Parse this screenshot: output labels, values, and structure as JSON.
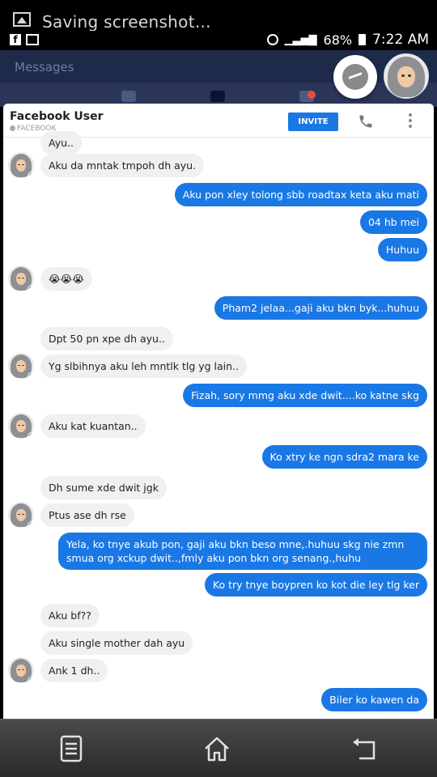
{
  "notification": {
    "text": "Saving screenshot..."
  },
  "status_bar": {
    "battery": "68%",
    "time": "7:22 AM"
  },
  "app_header": {
    "title": "Messages"
  },
  "conversation": {
    "name": "Facebook User",
    "source": "FACEBOOK",
    "invite_label": "INVITE"
  },
  "messages": [
    {
      "dir": "in",
      "text": "Ayu..",
      "avatar": false
    },
    {
      "dir": "in",
      "text": "Aku da mntak tmpoh dh ayu.",
      "avatar": true
    },
    {
      "dir": "out",
      "text": "Aku pon xley tolong sbb roadtax keta aku mati"
    },
    {
      "dir": "out",
      "text": "04 hb mei"
    },
    {
      "dir": "out",
      "text": "Huhuu"
    },
    {
      "dir": "in",
      "text": "😭😭😭",
      "avatar": true
    },
    {
      "dir": "out",
      "text": "Pham2 jelaa...gaji aku bkn byk...huhuu"
    },
    {
      "dir": "in",
      "text": "Dpt 50 pn xpe dh ayu..",
      "avatar": false
    },
    {
      "dir": "in",
      "text": "Yg slbihnya aku leh mntlk tlg yg lain..",
      "avatar": true
    },
    {
      "dir": "out",
      "text": "Fizah, sory mmg aku xde dwit....ko katne skg"
    },
    {
      "dir": "in",
      "text": "Aku kat kuantan..",
      "avatar": true
    },
    {
      "dir": "out",
      "text": "Ko xtry ke ngn sdra2 mara ke"
    },
    {
      "dir": "in",
      "text": "Dh sume xde dwit jgk",
      "avatar": false
    },
    {
      "dir": "in",
      "text": "Ptus ase dh rse",
      "avatar": true
    },
    {
      "dir": "out",
      "text": "Yela, ko tnye akub pon, gaji aku bkn beso mne,.huhuu skg nie zmn smua org xckup dwit..,fmly aku pon bkn org senang.,huhu"
    },
    {
      "dir": "out",
      "text": "Ko try tnye boypren ko kot die ley tlg ker"
    },
    {
      "dir": "in",
      "text": "Aku bf??",
      "avatar": false
    },
    {
      "dir": "in",
      "text": "Aku single mother dah ayu",
      "avatar": false
    },
    {
      "dir": "in",
      "text": "Ank 1 dh..",
      "avatar": true
    },
    {
      "dir": "out",
      "text": "Biler ko kawen da"
    }
  ],
  "colors": {
    "outgoing": "#1a78e5",
    "incoming": "#f1f0f0",
    "header": "#1e2a4a"
  },
  "icons": [
    "image-icon",
    "alarm-icon",
    "signal-icon",
    "battery-icon",
    "messenger-icon",
    "phone-icon",
    "more-vert-icon",
    "menu-icon",
    "home-icon",
    "back-icon"
  ]
}
